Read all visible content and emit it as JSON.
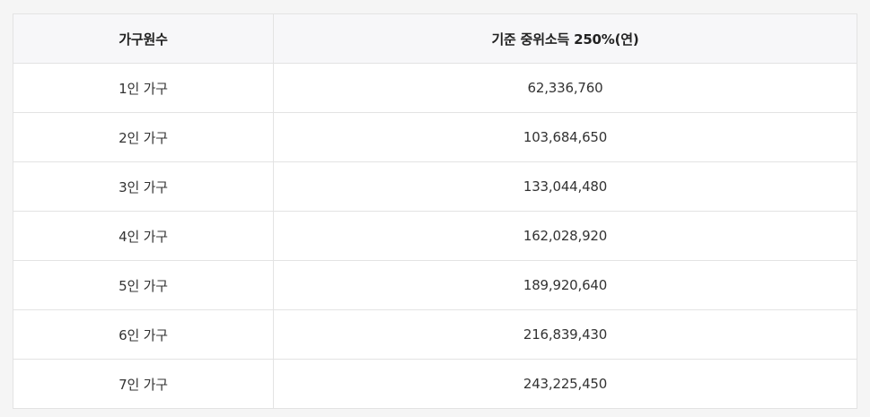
{
  "table": {
    "headers": [
      "가구원수",
      "기준 중위소득 250%(연)"
    ],
    "rows": [
      [
        "1인 가구",
        "62,336,760"
      ],
      [
        "2인 가구",
        "103,684,650"
      ],
      [
        "3인 가구",
        "133,044,480"
      ],
      [
        "4인 가구",
        "162,028,920"
      ],
      [
        "5인 가구",
        "189,920,640"
      ],
      [
        "6인 가구",
        "216,839,430"
      ],
      [
        "7인 가구",
        "243,225,450"
      ]
    ]
  }
}
